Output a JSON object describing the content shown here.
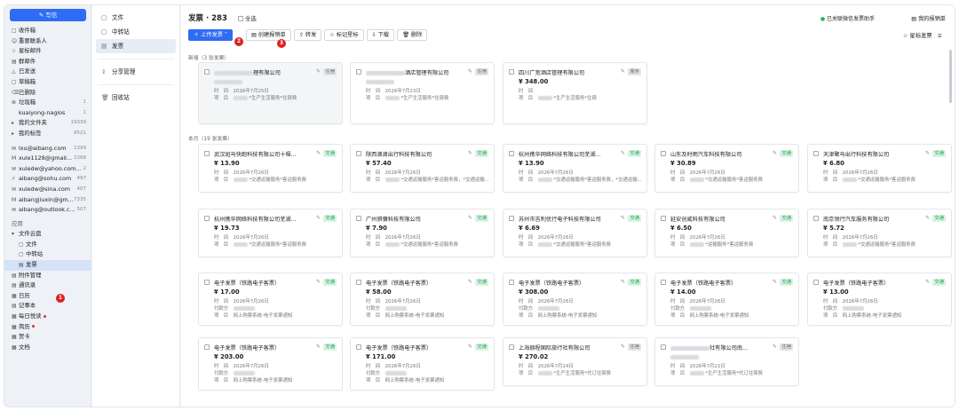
{
  "sidebar": {
    "write": "写信",
    "items": [
      {
        "icon": "□",
        "label": "收件箱",
        "count": ""
      },
      {
        "icon": "☺",
        "label": "重要联系人",
        "count": ""
      },
      {
        "icon": "☆",
        "label": "星标邮件",
        "count": ""
      },
      {
        "icon": "▤",
        "label": "群邮件",
        "count": ""
      },
      {
        "icon": "△",
        "label": "已发送",
        "count": ""
      },
      {
        "icon": "▢",
        "label": "草稿箱",
        "count": ""
      },
      {
        "icon": "⌫",
        "label": "已删除",
        "count": ""
      },
      {
        "icon": "⊗",
        "label": "垃圾箱",
        "count": "1"
      },
      {
        "icon": "",
        "label": "kuaiyong-nagios",
        "count": "1"
      },
      {
        "icon": "▸",
        "label": "我的文件夹",
        "count": "19339"
      },
      {
        "icon": "▸",
        "label": "我的标签",
        "count": "9521"
      },
      {
        "icon": "✉",
        "label": "lxu@aibang.com",
        "count": "1399"
      },
      {
        "icon": "M",
        "label": "xule1128@gmail...",
        "count": "2268"
      },
      {
        "icon": "✉",
        "label": "xuledw@yahoo.com...",
        "count": "2"
      },
      {
        "icon": "⚡",
        "label": "aibang@sohu.com",
        "count": "497"
      },
      {
        "icon": "✉",
        "label": "xuledw@sina.com",
        "count": "407"
      },
      {
        "icon": "M",
        "label": "aibangjiuxin@gm...",
        "count": "7335"
      },
      {
        "icon": "✉",
        "label": "aibang@outlook.c...",
        "count": "507"
      }
    ],
    "apps_title": "应用",
    "apps": [
      {
        "icon": "▾",
        "label": "文件云盘",
        "dot": false
      },
      {
        "icon": "▢",
        "label": "文件",
        "dot": false,
        "indent": true
      },
      {
        "icon": "▢",
        "label": "中转站",
        "dot": false,
        "indent": true
      },
      {
        "icon": "▤",
        "label": "发票",
        "dot": false,
        "indent": true,
        "selected": true
      },
      {
        "icon": "▤",
        "label": "附件管理",
        "dot": false
      },
      {
        "icon": "▤",
        "label": "通讯录",
        "dot": false
      },
      {
        "icon": "▦",
        "label": "日历",
        "dot": false
      },
      {
        "icon": "▤",
        "label": "记事本",
        "dot": false
      },
      {
        "icon": "▦",
        "label": "每日悦读",
        "dot": true
      },
      {
        "icon": "▦",
        "label": "简历",
        "dot": true
      },
      {
        "icon": "▦",
        "label": "贺卡",
        "dot": false
      },
      {
        "icon": "▦",
        "label": "文档",
        "dot": false
      }
    ]
  },
  "filepanel": {
    "items": [
      {
        "icon": "▢",
        "label": "文件"
      },
      {
        "icon": "▢",
        "label": "中转站"
      },
      {
        "icon": "▤",
        "label": "发票"
      }
    ],
    "share": "分享管理",
    "recycle": "回收站"
  },
  "header": {
    "title": "发票 · 283",
    "select_all": "全选",
    "wechat": "已关联微信发票助手",
    "my_reimb": "我的报销单"
  },
  "toolbar": {
    "upload": "上传发票",
    "create": "创建报销单",
    "forward": "转发",
    "star": "标记星标",
    "download": "下载",
    "delete": "删除",
    "star_filter": "星标发票"
  },
  "badges": {
    "b1": "1",
    "b2": "2",
    "b3": "3"
  },
  "sections": {
    "new": "新增（3 张发票）",
    "month": "本月（19 张发票）"
  },
  "labels": {
    "time": "时　间",
    "item": "项　目",
    "payer": "付款方",
    "pay": "付款方"
  },
  "new_cards": [
    {
      "name": "理有限公司",
      "amount": "",
      "tag": "住宿",
      "date": "2026年7月25日",
      "item": "*生产生活服务*住宿费",
      "blur": true
    },
    {
      "name": "酒店管理有限公司",
      "amount": "",
      "tag": "住宿",
      "date": "2026年7月23日",
      "item": "*生产生活服务*住宿费",
      "blur": true
    },
    {
      "name": "四川广宽酒店管理有限公司",
      "amount": "¥ 348.00",
      "tag": "服务",
      "date": "",
      "item": "*生产生活服务*住宿",
      "blur": false
    }
  ],
  "month_cards": [
    {
      "name": "武汉斑马快跑科技有限公司十堰...",
      "amount": "¥ 13.90",
      "tag": "交通",
      "date": "2026年7月26日",
      "item": "*交通运输服务*客运服务费"
    },
    {
      "name": "陕西滴滴出行科技有限公司",
      "amount": "¥ 57.40",
      "tag": "交通",
      "date": "2026年7月26日",
      "item": "*交通运输服务*客运服务费，*交通运输..."
    },
    {
      "name": "杭州携华网络科技有限公司芜湖...",
      "amount": "¥ 13.90",
      "tag": "交通",
      "date": "2026年7月26日",
      "item": "*交通运输服务*客运服务费，*交通运输..."
    },
    {
      "name": "山东及时雨汽车科技有限公司",
      "amount": "¥ 30.89",
      "tag": "交通",
      "date": "2026年7月26日",
      "item": "*交通运输服务*客运服务费"
    },
    {
      "name": "天津聚马出行科技有限公司",
      "amount": "¥ 6.80",
      "tag": "交通",
      "date": "2026年7月26日",
      "item": "*交通运输服务*客运服务费"
    },
    {
      "name": "杭州携华网络科技有限公司芜湖...",
      "amount": "¥ 19.73",
      "tag": "交通",
      "date": "2026年7月26日",
      "item": "*交通运输服务*客运服务费"
    },
    {
      "name": "广州骐骥科技有限公司",
      "amount": "¥ 7.90",
      "tag": "交通",
      "date": "2026年7月26日",
      "item": "*交通运输服务*客运服务费"
    },
    {
      "name": "苏州市吉利优行电子科技有限公司",
      "amount": "¥ 6.69",
      "tag": "交通",
      "date": "2026年7月26日",
      "item": "*交通运输服务*客运服务费"
    },
    {
      "name": "延安创威科技有限公司",
      "amount": "¥ 6.50",
      "tag": "交通",
      "date": "2026年7月26日",
      "item": "*运输服务*客运服务费"
    },
    {
      "name": "南京领行汽车服务有限公司",
      "amount": "¥ 5.72",
      "tag": "交通",
      "date": "2026年7月26日",
      "item": "*交通运输服务*客运服务费"
    },
    {
      "name": "电子发票（铁路电子客票）",
      "amount": "¥ 17.00",
      "tag": "交通",
      "date": "2026年7月26日",
      "item": "网上购票系统-电子发票通知",
      "payer": true
    },
    {
      "name": "电子发票（铁路电子客票）",
      "amount": "¥ 58.00",
      "tag": "交通",
      "date": "2026年7月26日",
      "item": "网上购票系统-电子发票通知",
      "payer": true
    },
    {
      "name": "电子发票（铁路电子客票）",
      "amount": "¥ 308.00",
      "tag": "交通",
      "date": "2026年7月26日",
      "item": "网上购票系统-电子发票通知",
      "payer": true
    },
    {
      "name": "电子发票（铁路电子客票）",
      "amount": "¥ 14.00",
      "tag": "交通",
      "date": "2026年7月26日",
      "item": "网上购票系统-电子发票通知",
      "payer": true
    },
    {
      "name": "电子发票（铁路电子客票）",
      "amount": "¥ 13.00",
      "tag": "交通",
      "date": "2026年7月26日",
      "item": "网上购票系统-电子发票通知",
      "payer": true
    },
    {
      "name": "电子发票（铁路电子客票）",
      "amount": "¥ 203.00",
      "tag": "交通",
      "date": "2026年7月26日",
      "item": "网上购票系统-电子发票通知",
      "payer": true
    },
    {
      "name": "电子发票（铁路电子客票）",
      "amount": "¥ 171.00",
      "tag": "交通",
      "date": "2026年7月26日",
      "item": "网上购票系统-电子发票通知",
      "payer": true
    },
    {
      "name": "上海赫程国际旅行社有限公司",
      "amount": "¥ 270.02",
      "tag": "住宿",
      "date": "2026年7月24日",
      "item": "*生产生活服务*代订住宿费"
    },
    {
      "name": "社有限公司南...",
      "amount": "",
      "tag": "住宿",
      "date": "2026年7月22日",
      "item": "*生产生活服务*代订住宿费",
      "blur": true
    }
  ]
}
